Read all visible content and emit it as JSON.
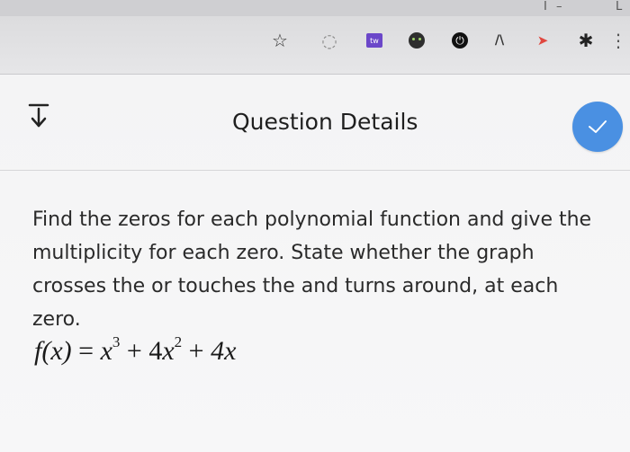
{
  "browser": {
    "window_controls": [
      "I",
      "–",
      "L"
    ],
    "extensions": [
      {
        "name": "star-icon",
        "glyph": "☆",
        "color": "#333333"
      },
      {
        "name": "refresh-ext-icon",
        "glyph": "◌",
        "color": "#8a8a8a"
      },
      {
        "name": "puzzle-tw-icon",
        "glyph": "tw",
        "color": "#6b47c9"
      },
      {
        "name": "tanuki-icon",
        "glyph": "●",
        "color": "#2e2e2e"
      },
      {
        "name": "power-icon",
        "glyph": "⏻",
        "color": "#111111"
      },
      {
        "name": "wave-icon",
        "glyph": "/\\",
        "color": "#333333"
      },
      {
        "name": "redirect-icon",
        "glyph": "➤",
        "color": "#e0473f"
      },
      {
        "name": "gear-icon",
        "glyph": "✱",
        "color": "#222222"
      },
      {
        "name": "menu-dots-icon",
        "glyph": "⋮",
        "color": "#555555"
      }
    ]
  },
  "panel": {
    "title": "Question Details",
    "accent_color": "#4a90e2"
  },
  "question": {
    "text": "Find the zeros for each polynomial function and give the multiplicity for each zero. State whether the graph crosses the or touches the and turns around, at each zero."
  },
  "formula": {
    "lhs": "f(x)",
    "equals": "=",
    "term1_base": "x",
    "term1_exp": "3",
    "plus1": "+",
    "term2_coef": "4",
    "term2_base": "x",
    "term2_exp": "2",
    "plus2": "+",
    "term3": "4x"
  }
}
